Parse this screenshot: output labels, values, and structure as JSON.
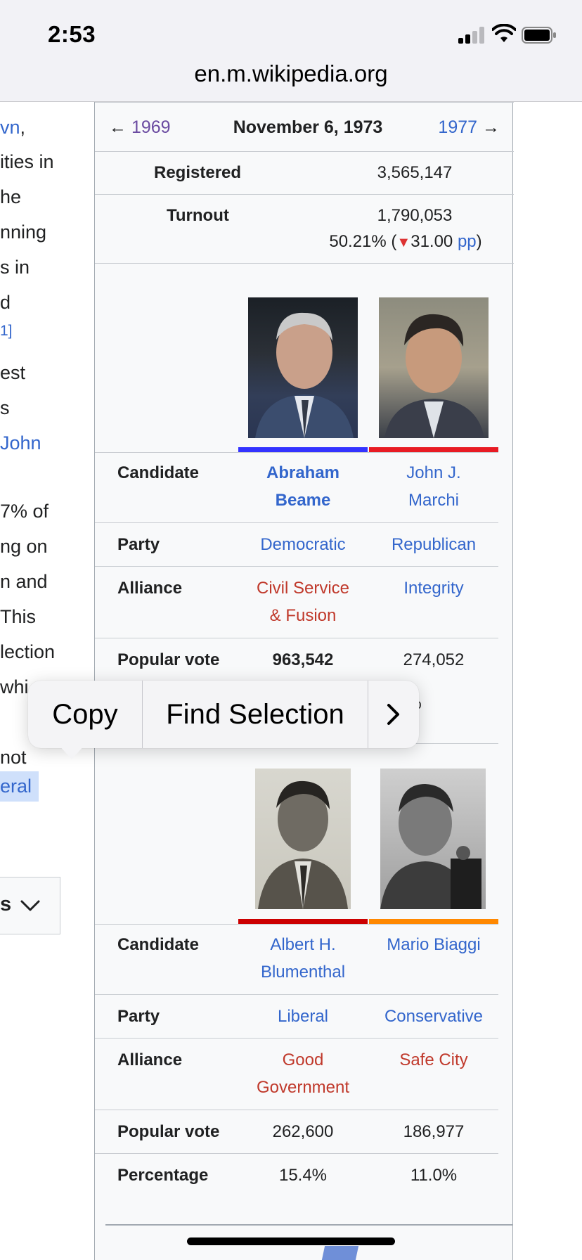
{
  "status_bar": {
    "time": "2:53"
  },
  "browser": {
    "url": "en.m.wikipedia.org"
  },
  "article_fragments": [
    {
      "text": "vn,",
      "style": "link-comma"
    },
    {
      "text": "ities in",
      "style": "text"
    },
    {
      "text": "he",
      "style": "text"
    },
    {
      "text": "nning",
      "style": "text"
    },
    {
      "text": "s in",
      "style": "text"
    },
    {
      "text": "d",
      "style": "text"
    },
    {
      "text": "1]",
      "style": "sup"
    },
    {
      "text": "est",
      "style": "text"
    },
    {
      "text": "s",
      "style": "text"
    },
    {
      "text": "John",
      "style": "link"
    },
    {
      "text": "7% of",
      "style": "text"
    },
    {
      "text": "ng on",
      "style": "text"
    },
    {
      "text": "n and",
      "style": "text"
    },
    {
      "text": " This",
      "style": "text"
    },
    {
      "text": "lection",
      "style": "text"
    },
    {
      "text": "whi",
      "style": "text"
    },
    {
      "text": "not",
      "style": "text"
    },
    {
      "text": "eral",
      "style": "selected"
    }
  ],
  "collapsed_section": {
    "label": "s"
  },
  "infobox": {
    "nav": {
      "prev_arrow": "←",
      "prev_year": "1969",
      "date": "November 6, 1973",
      "next_year": "1977",
      "next_arrow": "→"
    },
    "registered": {
      "label": "Registered",
      "value": "3,565,147"
    },
    "turnout": {
      "label": "Turnout",
      "value": "1,790,053",
      "pct": "50.21%",
      "open": "(",
      "change_icon": "▼",
      "change": "31.00",
      "unit": "pp",
      "close": ")"
    },
    "labels": {
      "candidate": "Candidate",
      "party": "Party",
      "alliance": "Alliance",
      "popular_vote": "Popular vote",
      "percentage": "Percentage"
    },
    "candidates_top": [
      {
        "name_line1": "Abraham",
        "name_line2": "Beame",
        "party": "Democratic",
        "alliance_line1": "Civil Service",
        "alliance_line2": "& Fusion",
        "popular_vote": "963,542",
        "color": "#3333ff",
        "winner": true
      },
      {
        "name_line1": "John J.",
        "name_line2": "Marchi",
        "party": "Republican",
        "alliance_line1": "Integrity",
        "alliance_line2": "",
        "popular_vote": "274,052",
        "percentage": "6.1%",
        "color": "#e81b23",
        "winner": false
      }
    ],
    "candidates_bottom": [
      {
        "name_line1": "Albert H.",
        "name_line2": "Blumenthal",
        "party": "Liberal",
        "alliance_line1": "Good",
        "alliance_line2": "Government",
        "popular_vote": "262,600",
        "percentage": "15.4%",
        "color": "#cc0000"
      },
      {
        "name_line1": "Mario Biaggi",
        "name_line2": "",
        "party": "Conservative",
        "alliance_line1": "Safe City",
        "alliance_line2": "",
        "popular_vote": "186,977",
        "percentage": "11.0%",
        "color": "#ff8800"
      }
    ]
  },
  "context_menu": {
    "copy": "Copy",
    "find_selection": "Find Selection",
    "more": "›"
  }
}
